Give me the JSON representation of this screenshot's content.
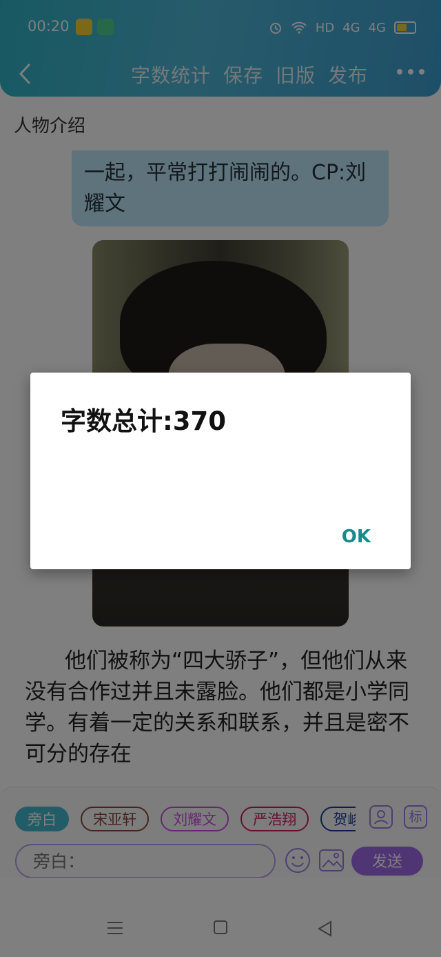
{
  "status_bar": {
    "time": "00:20",
    "network_label": "HD",
    "signal1": "4G",
    "signal2": "4G"
  },
  "toolbar": {
    "word_count_label": "字数统计",
    "save_label": "保存",
    "old_version_label": "旧版",
    "publish_label": "发布"
  },
  "section_title": "人物介绍",
  "content": {
    "bubble_text": "一起，平常打打闹闹的。CP:刘耀文",
    "paragraph": "他们被称为“四大骄子”，但他们从来没有合作过并且未露脸。他们都是小学同学。有着一定的关系和联系，并且是密不可分的存在"
  },
  "composer": {
    "roles": [
      "旁白",
      "宋亚轩",
      "刘耀文",
      "严浩翔",
      "贺峻"
    ],
    "tag_button_label": "标",
    "input_placeholder": "旁白：",
    "send_label": "发送"
  },
  "dialog": {
    "message": "字数总计:370",
    "ok_label": "OK"
  },
  "colors": {
    "header_accent": "#3fb0cf",
    "send_button": "#a06ae8",
    "dialog_ok": "#178a8a"
  }
}
